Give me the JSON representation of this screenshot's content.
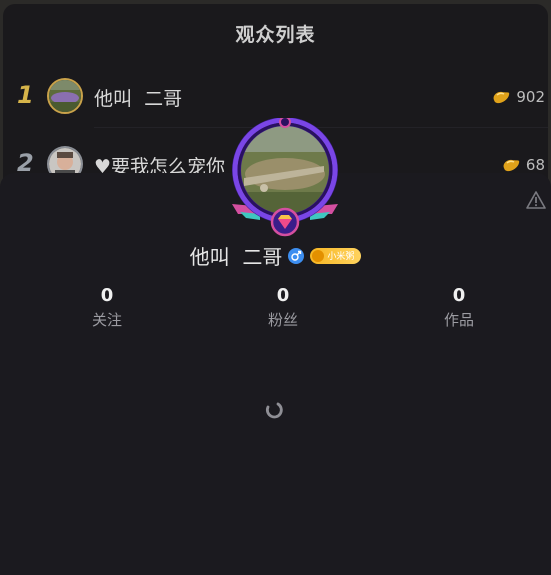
{
  "viewer_list": {
    "title": "观众列表",
    "rows": [
      {
        "rank": "1",
        "name": "他叫  二哥",
        "score": "902"
      },
      {
        "rank": "2",
        "name": "♥要我怎么宠你",
        "score": "68"
      }
    ]
  },
  "profile": {
    "name": "他叫  二哥",
    "gender_icon": "male-icon",
    "level_badge": "小米粥",
    "stats": [
      {
        "value": "0",
        "label": "关注"
      },
      {
        "value": "0",
        "label": "粉丝"
      },
      {
        "value": "0",
        "label": "作品"
      }
    ],
    "report_icon": "warning-triangle-icon",
    "loading_icon": "spinner-icon"
  },
  "colors": {
    "rank1": "#d6b44a",
    "rank2": "#9aa0a8",
    "frame": "#6a35d6",
    "badge": "#f7b623",
    "gender": "#3d8ef0"
  }
}
